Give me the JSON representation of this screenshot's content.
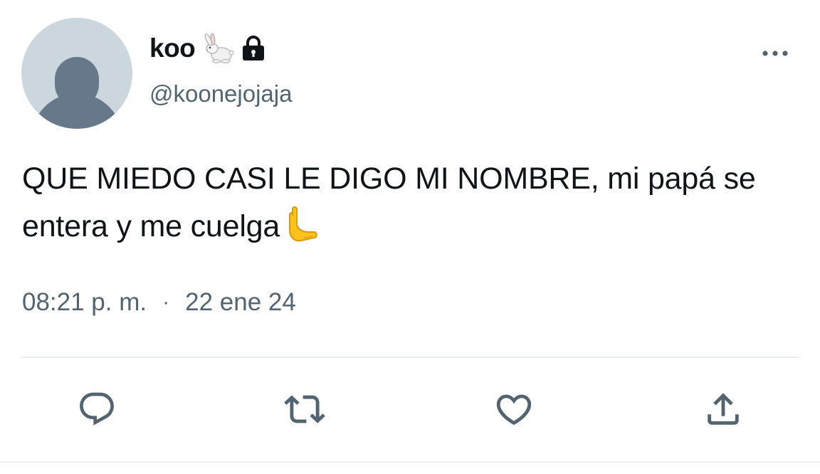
{
  "user": {
    "display_name": "koo",
    "handle": "@koonejojaja",
    "name_icons": [
      "rabbit-emoji",
      "lock-icon"
    ]
  },
  "tweet": {
    "text": "QUE MIEDO CASI LE DIGO MI NOMBRE, mi papá se entera y me cuelga",
    "trailing_emoji": "hand-emoji",
    "time": "08:21 p. m.",
    "separator": "·",
    "date": "22 ene 24"
  },
  "actions": [
    "reply-icon",
    "retweet-icon",
    "like-icon",
    "share-icon"
  ],
  "colors": {
    "text": "#0f1419",
    "secondary": "#536471",
    "avatar_bg": "#ccd6dd",
    "avatar_fg": "#66788a"
  }
}
